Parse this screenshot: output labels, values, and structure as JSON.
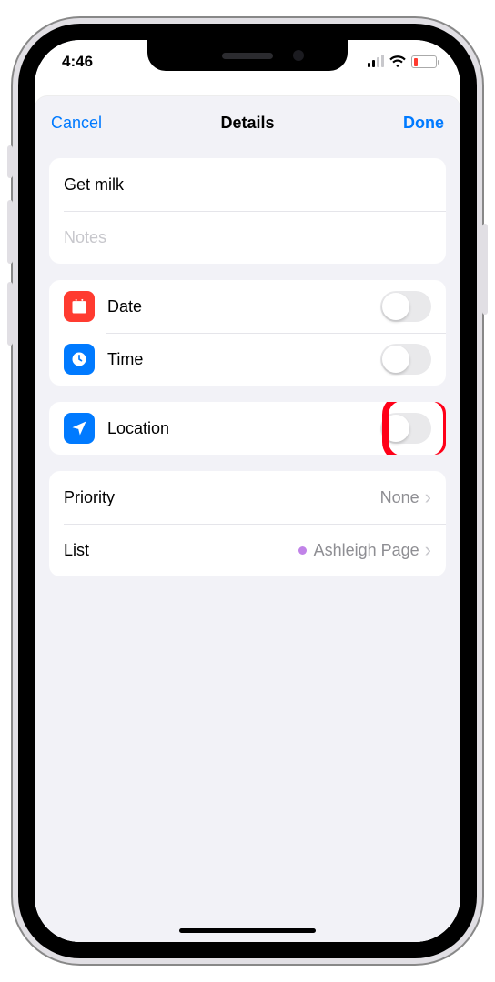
{
  "status": {
    "time": "4:46"
  },
  "nav": {
    "cancel": "Cancel",
    "title": "Details",
    "done": "Done"
  },
  "fields": {
    "title_value": "Get milk",
    "notes_placeholder": "Notes"
  },
  "rows": {
    "date": {
      "label": "Date"
    },
    "time": {
      "label": "Time"
    },
    "location": {
      "label": "Location"
    },
    "priority": {
      "label": "Priority",
      "value": "None"
    },
    "list": {
      "label": "List",
      "value": "Ashleigh Page"
    }
  }
}
